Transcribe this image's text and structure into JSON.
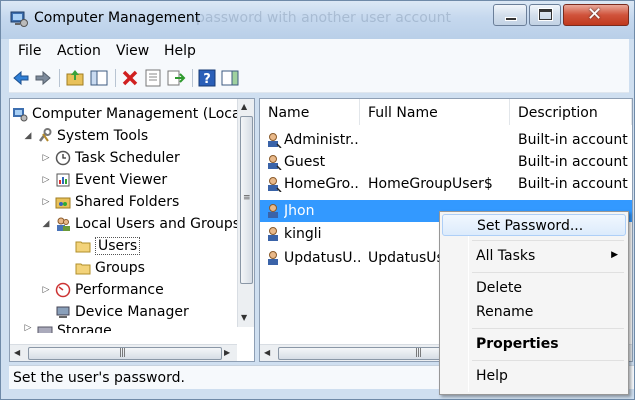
{
  "window": {
    "title": "Computer Management",
    "ghost_text": "password with another user account"
  },
  "menu": [
    "File",
    "Action",
    "View",
    "Help"
  ],
  "toolbar": [
    "back-arrow-icon",
    "forward-arrow-icon",
    "up-folder-icon",
    "show-hide-tree-icon",
    "delete-icon",
    "properties-icon",
    "export-list-icon",
    "help-icon",
    "show-action-pane-icon"
  ],
  "tree": [
    {
      "label": "Computer Management (Loca",
      "icon": "computer-management-icon"
    },
    {
      "label": "System Tools",
      "icon": "tools-icon"
    },
    {
      "label": "Task Scheduler",
      "icon": "clock-icon"
    },
    {
      "label": "Event Viewer",
      "icon": "event-viewer-icon"
    },
    {
      "label": "Shared Folders",
      "icon": "shared-folder-icon"
    },
    {
      "label": "Local Users and Groups",
      "icon": "users-groups-icon"
    },
    {
      "label": "Users",
      "icon": "folder-icon"
    },
    {
      "label": "Groups",
      "icon": "folder-icon"
    },
    {
      "label": "Performance",
      "icon": "performance-icon"
    },
    {
      "label": "Device Manager",
      "icon": "device-manager-icon"
    },
    {
      "label": "Storage",
      "icon": "storage-icon"
    }
  ],
  "list": {
    "columns": [
      "Name",
      "Full Name",
      "Description"
    ],
    "rows": [
      {
        "name": "Administr...",
        "full_name": "",
        "description": "Built-in account"
      },
      {
        "name": "Guest",
        "full_name": "",
        "description": "Built-in account"
      },
      {
        "name": "HomeGro...",
        "full_name": "HomeGroupUser$",
        "description": "Built-in account"
      },
      {
        "name": "Jhon",
        "full_name": "",
        "description": ""
      },
      {
        "name": "kingli",
        "full_name": "",
        "description": ""
      },
      {
        "name": "UpdatusU...",
        "full_name": "UpdatusUs",
        "description": ""
      }
    ]
  },
  "context_menu": {
    "set_password": "Set Password...",
    "all_tasks": "All Tasks",
    "delete": "Delete",
    "rename": "Rename",
    "properties": "Properties",
    "help": "Help"
  },
  "status": "Set the user's password.",
  "colors": {
    "selection": "#3399ff",
    "title_bar": "#c5d8ee",
    "close_button": "#c0391d"
  }
}
